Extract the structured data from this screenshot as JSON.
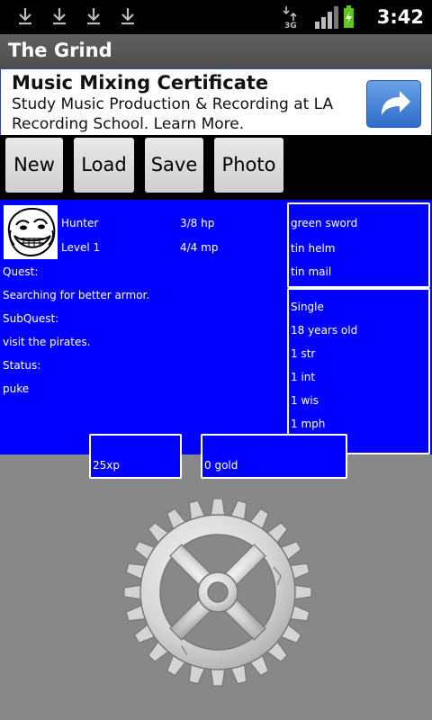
{
  "status_bar": {
    "time": "3:42",
    "network": "3G",
    "notifications": [
      "download-icon",
      "download-icon",
      "download-icon",
      "download-icon"
    ]
  },
  "app": {
    "title": "The Grind"
  },
  "ad": {
    "title": "Music Mixing Certificate",
    "text": "Study Music Production & Recording at LA Recording School. Learn More."
  },
  "toolbar": {
    "new_label": "New",
    "load_label": "Load",
    "save_label": "Save",
    "photo_label": "Photo"
  },
  "character": {
    "class": "Hunter",
    "level": "Level 1",
    "hp": "3/8 hp",
    "mp": "4/4 mp",
    "quest_label": "Quest:",
    "quest": "Searching for better armor.",
    "subquest_label": "SubQuest:",
    "subquest": "visit the pirates.",
    "status_label": "Status:",
    "status": "puke"
  },
  "equipment": {
    "weapon": "green sword",
    "helm": "tin helm",
    "armor": "tin mail"
  },
  "stats": {
    "relationship": "Single",
    "age": "18 years old",
    "str": "1 str",
    "int": "1 int",
    "wis": "1 wis",
    "mph": "1 mph"
  },
  "xp": "25xp",
  "gold": "0 gold",
  "colors": {
    "panel": "#0000ff",
    "background": "#888888"
  }
}
